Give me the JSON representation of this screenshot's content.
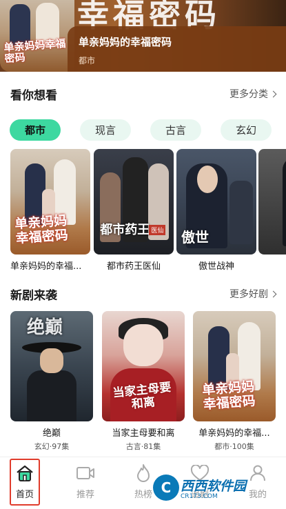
{
  "hero": {
    "title": "单亲妈妈的幸福密码",
    "genre": "都市",
    "poster_text": "单亲妈妈幸福密码",
    "backdrop_text": "幸福密码"
  },
  "section1": {
    "title": "看你想看",
    "more": "更多分类"
  },
  "chips": [
    {
      "label": "都市",
      "active": true
    },
    {
      "label": "现言",
      "active": false
    },
    {
      "label": "古言",
      "active": false
    },
    {
      "label": "玄幻",
      "active": false
    }
  ],
  "row1": [
    {
      "title": "单亲妈妈的幸福...",
      "poster_text": "单亲妈妈幸福密码"
    },
    {
      "title": "都市药王医仙",
      "poster_text": "都市药王",
      "poster_tag": "医仙"
    },
    {
      "title": "傲世战神",
      "poster_text": "傲世"
    },
    {
      "title": ""
    }
  ],
  "section2": {
    "title": "新剧来袭",
    "more": "更多好剧"
  },
  "row2": [
    {
      "title": "绝巅",
      "meta": "玄幻·97集",
      "poster_text": "绝巅"
    },
    {
      "title": "当家主母要和离",
      "meta": "古言·81集",
      "poster_text": "当家主母要和离"
    },
    {
      "title": "单亲妈妈的幸福...",
      "meta": "都市·100集",
      "poster_text": "单亲妈妈幸福密码"
    }
  ],
  "nav": [
    {
      "label": "首页",
      "icon": "home-icon",
      "active": true
    },
    {
      "label": "推荐",
      "icon": "video-icon",
      "active": false
    },
    {
      "label": "热榜",
      "icon": "flame-icon",
      "active": false
    },
    {
      "label": "追剧",
      "icon": "heart-icon",
      "active": false
    },
    {
      "label": "我的",
      "icon": "person-icon",
      "active": false
    }
  ],
  "watermark": {
    "main": "西西软件园",
    "sub": "CR173.COM",
    "badge": "C"
  },
  "colors": {
    "accent": "#3dd8a0",
    "chip_bg": "#e9f7f1",
    "highlight": "#e03b2b"
  }
}
